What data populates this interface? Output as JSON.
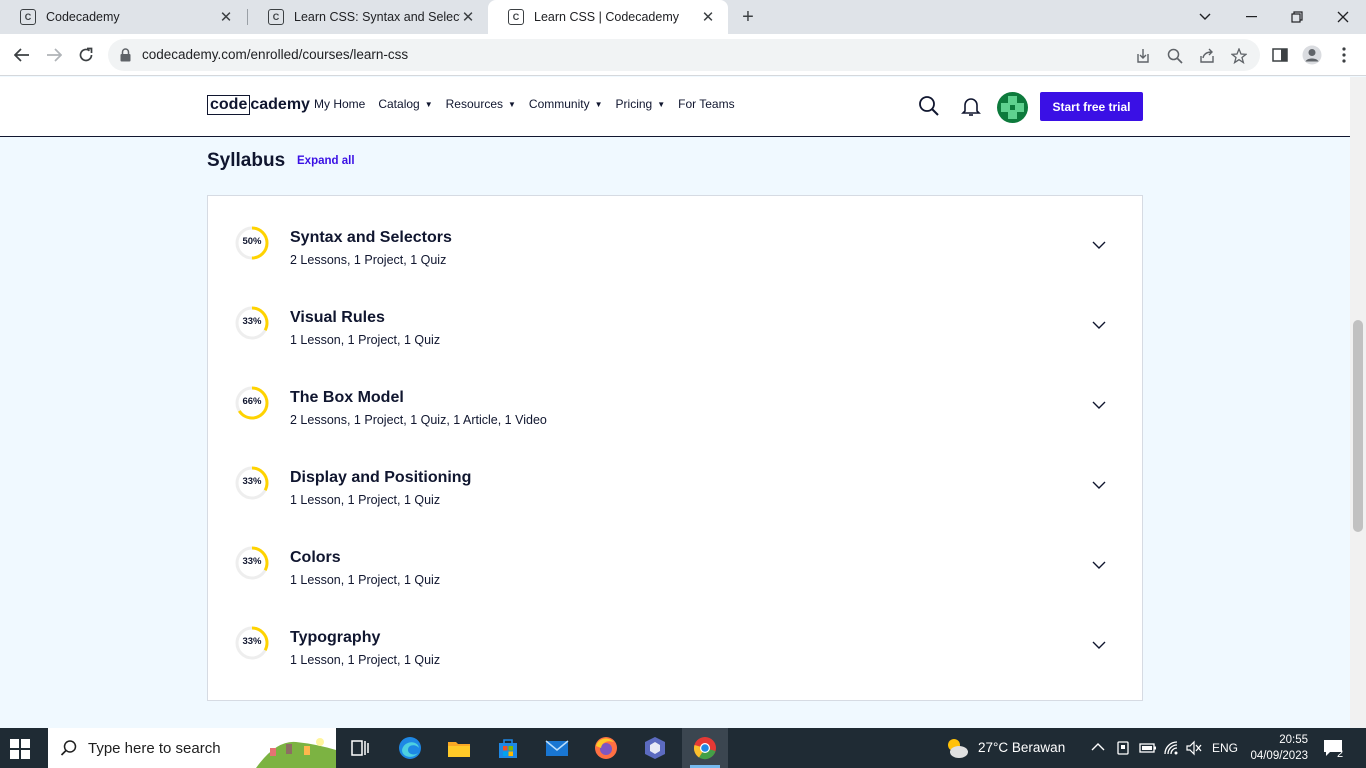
{
  "browser": {
    "tabs": [
      {
        "title": "Codecademy"
      },
      {
        "title": "Learn CSS: Syntax and Selectors C"
      },
      {
        "title": "Learn CSS | Codecademy"
      }
    ],
    "url": "codecademy.com/enrolled/courses/learn-css"
  },
  "header": {
    "logo_part1": "code",
    "logo_part2": "cademy",
    "nav": [
      {
        "label": "My Home",
        "caret": ""
      },
      {
        "label": "Catalog",
        "caret": "▼"
      },
      {
        "label": "Resources",
        "caret": "▼"
      },
      {
        "label": "Community",
        "caret": "▼"
      },
      {
        "label": "Pricing",
        "caret": "▼"
      },
      {
        "label": "For Teams",
        "caret": ""
      }
    ],
    "cta": "Start free trial",
    "accent": "#3a10e5"
  },
  "syllabus": {
    "title": "Syllabus",
    "expand_label": "Expand all",
    "modules": [
      {
        "progress": 0.5,
        "progress_label": "50%",
        "title": "Syntax and Selectors",
        "summary": "2 Lessons, 1 Project, 1 Quiz"
      },
      {
        "progress": 0.33,
        "progress_label": "33%",
        "title": "Visual Rules",
        "summary": "1 Lesson, 1 Project, 1 Quiz"
      },
      {
        "progress": 0.66,
        "progress_label": "66%",
        "title": "The Box Model",
        "summary": "2 Lessons, 1 Project, 1 Quiz, 1 Article, 1 Video"
      },
      {
        "progress": 0.33,
        "progress_label": "33%",
        "title": "Display and Positioning",
        "summary": "1 Lesson, 1 Project, 1 Quiz"
      },
      {
        "progress": 0.33,
        "progress_label": "33%",
        "title": "Colors",
        "summary": "1 Lesson, 1 Project, 1 Quiz"
      },
      {
        "progress": 0.33,
        "progress_label": "33%",
        "title": "Typography",
        "summary": "1 Lesson, 1 Project, 1 Quiz"
      }
    ],
    "progress_color": "#ffd300"
  },
  "taskbar": {
    "search_placeholder": "Type here to search",
    "weather": "27°C  Berawan",
    "language": "ENG",
    "time": "20:55",
    "date": "04/09/2023",
    "notification_count": "2"
  }
}
